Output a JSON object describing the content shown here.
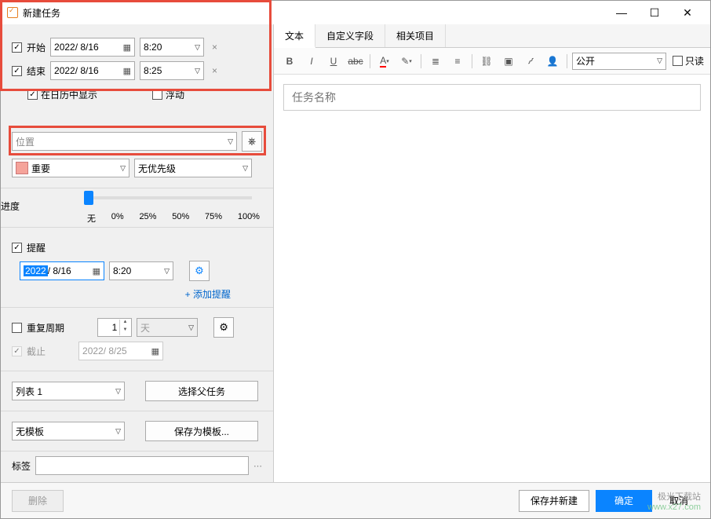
{
  "title": "新建任务",
  "dates": {
    "start_label": "开始",
    "start_date": "2022/ 8/16",
    "start_time": "8:20",
    "end_label": "结束",
    "end_date": "2022/ 8/16",
    "end_time": "8:25",
    "show_in_calendar": "在日历中显示",
    "floating": "浮动"
  },
  "location_placeholder": "位置",
  "category": {
    "label": "重要"
  },
  "priority": {
    "label": "无优先级"
  },
  "progress": {
    "label": "进度",
    "ticks": [
      "无",
      "0%",
      "25%",
      "50%",
      "75%",
      "100%"
    ]
  },
  "reminder": {
    "label": "提醒",
    "date_year": "2022",
    "date_rest": "/ 8/16",
    "time": "8:20",
    "add": "+ 添加提醒"
  },
  "repeat": {
    "label": "重复周期",
    "count": "1",
    "unit": "天",
    "due_label": "截止",
    "due_date": "2022/ 8/25"
  },
  "list": {
    "selected": "列表 1",
    "parent_btn": "选择父任务"
  },
  "template": {
    "selected": "无模板",
    "save_btn": "保存为模板..."
  },
  "tags_label": "标签",
  "tabs": [
    "文本",
    "自定义字段",
    "相关项目"
  ],
  "visibility": "公开",
  "readonly_label": "只读",
  "task_name_placeholder": "任务名称",
  "buttons": {
    "delete": "删除",
    "save_new": "保存并新建",
    "ok": "确定",
    "cancel": "取消"
  },
  "watermark": {
    "line1": "极光下载站",
    "line2": "www.x27.com"
  }
}
